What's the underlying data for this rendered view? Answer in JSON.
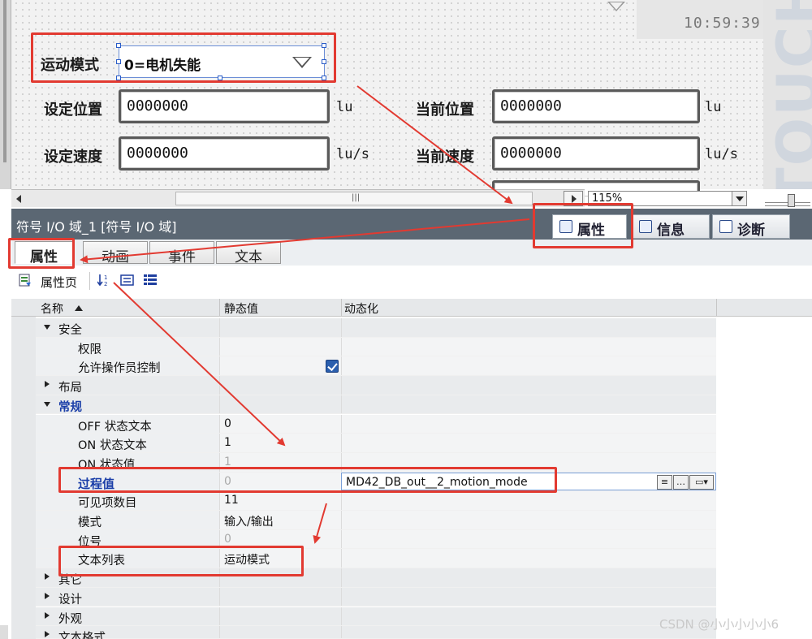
{
  "canvas": {
    "clock_time": "10:59:39",
    "brand_text": "TOUCH",
    "motion_mode": {
      "label": "运动模式",
      "value": "0=电机失能"
    },
    "fields": [
      {
        "label": "设定位置",
        "value": "0000000",
        "unit": "lu"
      },
      {
        "label": "当前位置",
        "value": "0000000",
        "unit": "lu"
      },
      {
        "label": "设定速度",
        "value": "0000000",
        "unit": "lu/s"
      },
      {
        "label": "当前速度",
        "value": "0000000",
        "unit": "lu/s"
      }
    ],
    "zoom": "115%",
    "scroll_thumb_glyph": "|||"
  },
  "inspector": {
    "title": "符号 I/O 域_1 [符号 I/O 域]",
    "top_tabs": [
      "属性",
      "信息",
      "诊断"
    ],
    "sub_tabs": [
      "属性",
      "动画",
      "事件",
      "文本"
    ],
    "toolbar_label": "属性页",
    "columns": {
      "name": "名称",
      "static": "静态值",
      "dynamic": "动态化"
    },
    "rows": {
      "security": "安全",
      "authorization": "权限",
      "allow_operator": "允许操作员控制",
      "layout": "布局",
      "general": "常规",
      "off_text": "OFF 状态文本",
      "off_value": "0",
      "on_text": "ON 状态文本",
      "on_value": "1",
      "on_state_value": "ON 状态值",
      "on_state_val": "1",
      "process_value": "过程值",
      "process_static": "0",
      "process_dynamic": "MD42_DB_out__2_motion_mode",
      "visible_items": "可见项数目",
      "visible_items_value": "11",
      "mode": "模式",
      "mode_value": "输入/输出",
      "bit_no": "位号",
      "bit_no_value": "0",
      "text_list": "文本列表",
      "text_list_value": "运动模式",
      "misc": "其它",
      "design": "设计",
      "appearance": "外观",
      "text_format": "文本格式"
    }
  },
  "watermark": "CSDN @小小小小小6",
  "colors": {
    "annotation_red": "#e23a31",
    "title_bar": "#5b6773",
    "link_blue": "#1a3ea8"
  }
}
